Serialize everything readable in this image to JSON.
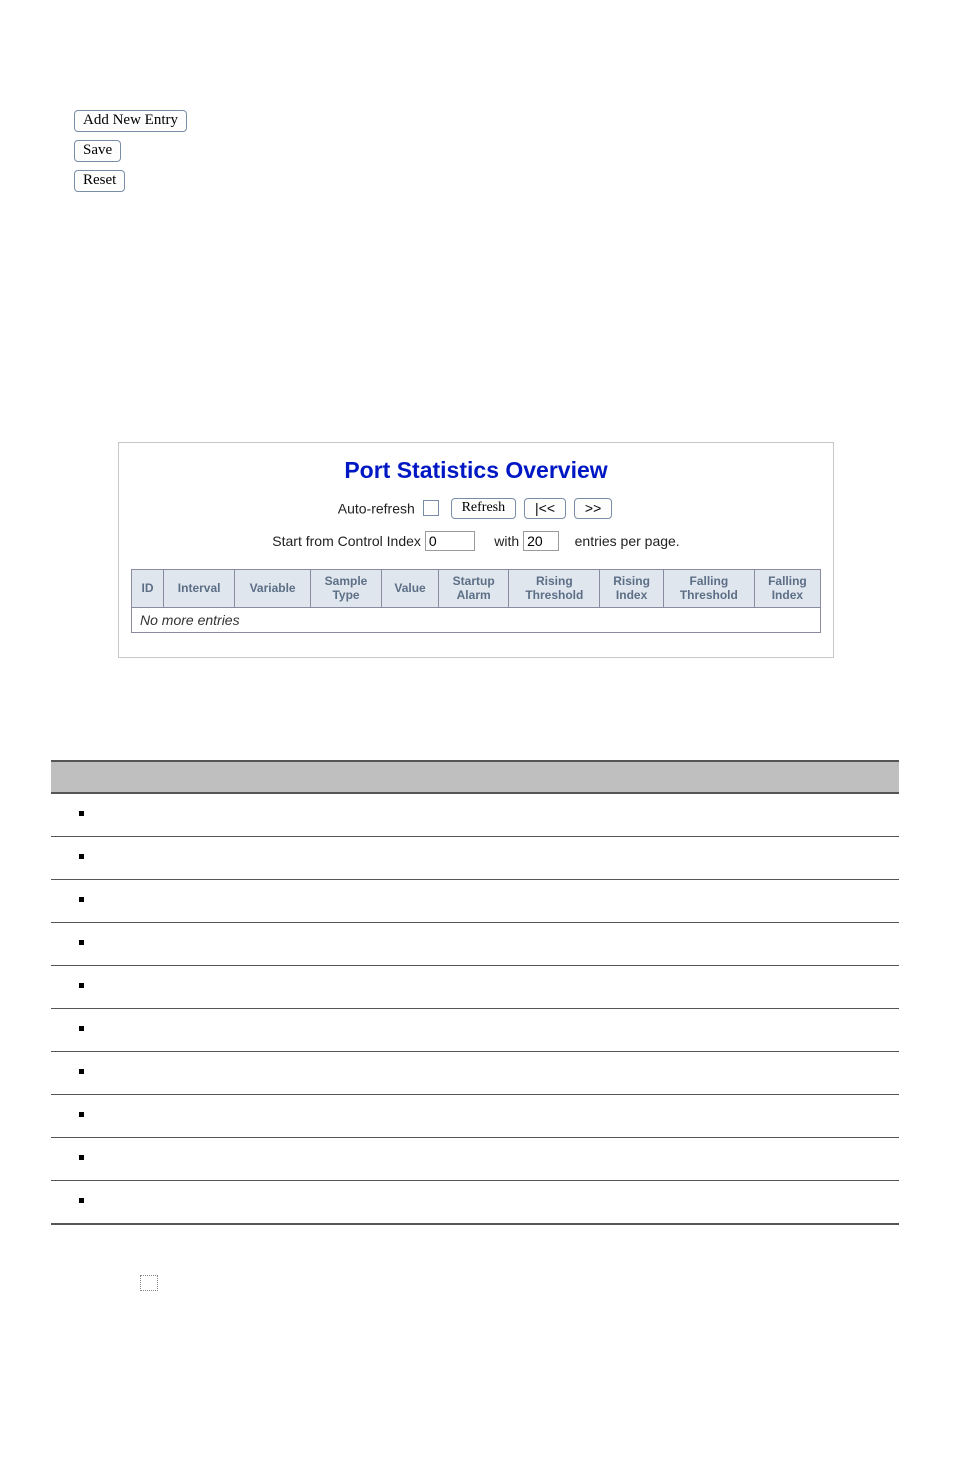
{
  "top_buttons": {
    "add_new_entry": "Add New Entry",
    "save": "Save",
    "reset": "Reset"
  },
  "overview": {
    "title": "Port Statistics Overview",
    "auto_refresh_label": "Auto-refresh",
    "auto_refresh_checked": false,
    "refresh_label": "Refresh",
    "first_label": "|<<",
    "next_label": ">>",
    "start_from_label": "Start from Control Index",
    "start_from_value": "0",
    "with_label": "with",
    "entries_value": "20",
    "entries_suffix": "entries per page.",
    "columns": [
      "ID",
      "Interval",
      "Variable",
      "Sample\nType",
      "Value",
      "Startup\nAlarm",
      "Rising\nThreshold",
      "Rising\nIndex",
      "Falling\nThreshold",
      "Falling\nIndex"
    ],
    "no_more": "No more entries"
  },
  "skeleton": {
    "row_count": 10
  }
}
